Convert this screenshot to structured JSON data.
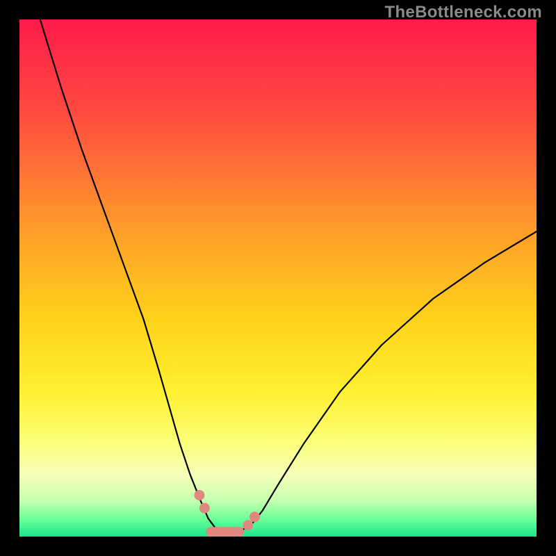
{
  "watermark": "TheBottleneck.com",
  "chart_data": {
    "type": "line",
    "title": "",
    "xlabel": "",
    "ylabel": "",
    "xlim": [
      0,
      100
    ],
    "ylim": [
      0,
      100
    ],
    "series": [
      {
        "name": "bottleneck-curve",
        "color": "#000000",
        "x": [
          4,
          8,
          12,
          16,
          20,
          24,
          27,
          29,
          31,
          33,
          35,
          36.5,
          38,
          39.5,
          41,
          43,
          45,
          47,
          50,
          55,
          62,
          70,
          80,
          90,
          100
        ],
        "y": [
          100,
          87,
          75,
          64,
          53,
          42,
          32,
          25,
          18,
          12,
          7,
          3.5,
          1.5,
          0.8,
          0.8,
          1.2,
          2.5,
          5,
          10,
          18,
          28,
          37,
          46,
          53,
          59
        ]
      }
    ],
    "markers": {
      "name": "highlight-points",
      "color": "#e08880",
      "points": [
        {
          "x": 34.8,
          "y": 8
        },
        {
          "x": 35.8,
          "y": 5.5
        },
        {
          "x": 44.2,
          "y": 2.2
        },
        {
          "x": 45.5,
          "y": 3.8
        }
      ]
    },
    "floor_band": {
      "name": "bottom-segment",
      "color": "#e08880",
      "y": 0.9,
      "x_start": 37,
      "x_end": 42.5
    },
    "gradient_bg": {
      "stops": [
        {
          "offset": 0.0,
          "color": "#ff1b4b"
        },
        {
          "offset": 0.18,
          "color": "#ff4a40"
        },
        {
          "offset": 0.4,
          "color": "#ff9a2a"
        },
        {
          "offset": 0.58,
          "color": "#ffd21a"
        },
        {
          "offset": 0.72,
          "color": "#fff030"
        },
        {
          "offset": 0.82,
          "color": "#fbff7a"
        },
        {
          "offset": 0.88,
          "color": "#f6ffb8"
        },
        {
          "offset": 0.93,
          "color": "#c7ffb0"
        },
        {
          "offset": 0.965,
          "color": "#6fff9a"
        },
        {
          "offset": 1.0,
          "color": "#17e88a"
        }
      ]
    }
  }
}
